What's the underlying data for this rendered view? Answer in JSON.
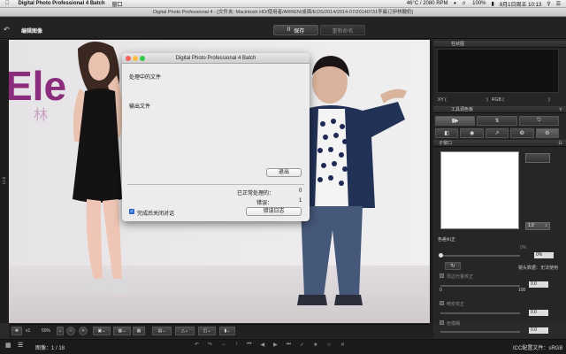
{
  "menubar": {
    "app_name": "Digital Photo Professional 4 Batch",
    "menu_window": "窗口",
    "status_temp": "46°C / 2080 RPM",
    "battery": "100%",
    "datetime": "8月1日周五  10:13"
  },
  "window_title": "Digital Photo Professional 4 - [文件夹: Macintosh HD/使用者/ARREN/桌面/EOS/2014/2014-07/20140731李晨订伊林酸奶]",
  "toolbar": {
    "edit_label": "编辑图像",
    "save_label": "保存",
    "rename_label": "重新命名"
  },
  "dialog": {
    "title": "Digital Photo Professional 4 Batch",
    "processing_label": "处理中的文件",
    "output_label": "输出文件",
    "exit_label": "退出",
    "processed_label": "已正常处理的：",
    "processed_count": "0",
    "errors_label": "错误：",
    "errors_count": "1",
    "close_on_finish_label": "完成后关闭对话",
    "error_log_label": "错误日志"
  },
  "right_panel": {
    "histogram_title": "柱状图",
    "xy_label": "XY (",
    "xy_close": ")",
    "rgb_label": "RGB (",
    "rgb_close": ")",
    "tool_palette_title": "工具调色板",
    "subwindow_title": "子窗口",
    "zoom_value": "1:2",
    "lens_aberration": "色差纠正",
    "slider1_value": "0%",
    "slider_scale_0": "0",
    "slider_scale_100": "100",
    "lens_info": "镜头数据：无法使用",
    "peripheral_label": "周边光量校正",
    "peripheral_value": "0.0",
    "distortion_label": "畸变校正",
    "distortion_value": "0.0",
    "color_blur_label": "色模糊",
    "color_blur_value": "0.0",
    "pct_value": "0%"
  },
  "bottom_toolbar": {
    "zoom_level": "50%",
    "x1_label": "x1"
  },
  "status_bar": {
    "image_count": "图像：1 / 18",
    "icc_text": "ICC配置文件：sRGB"
  },
  "colors": {
    "accent_blue": "#3a77d8",
    "close_light": "#fc605c",
    "minimize_light": "#fdbc40",
    "zoom_light": "#34c84a"
  }
}
